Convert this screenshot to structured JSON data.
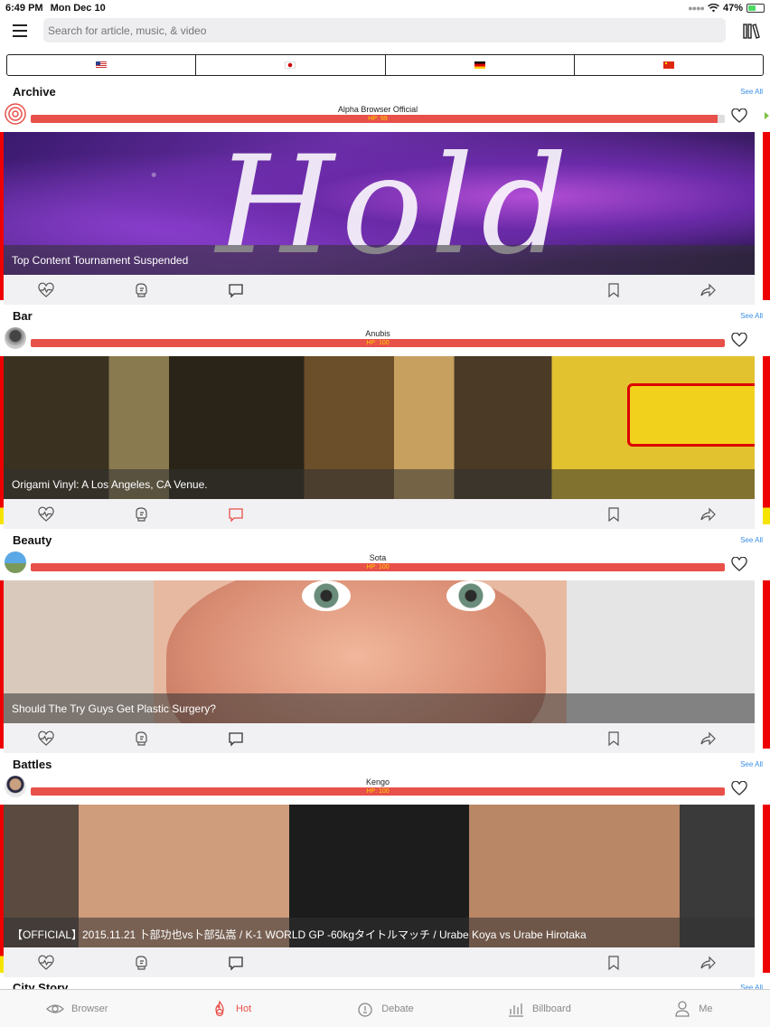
{
  "status_bar": {
    "time": "6:49 PM",
    "date": "Mon Dec 10",
    "battery": "47%",
    "battery_level": 0.47
  },
  "search": {
    "placeholder": "Search for article, music, & video"
  },
  "flag_tabs": [
    {
      "icon": "us-flag-icon"
    },
    {
      "icon": "japan-flag-icon"
    },
    {
      "icon": "germany-flag-icon"
    },
    {
      "icon": "china-flag-icon"
    }
  ],
  "see_all_label": "See All",
  "sections": [
    {
      "title": "Archive",
      "author": "Alpha Browser Official",
      "hp_label": "HP: 99",
      "hp_value": 99,
      "caption": "Top Content Tournament Suspended",
      "comment_active": false,
      "image_text": "Hold"
    },
    {
      "title": "Bar",
      "author": "Anubis",
      "hp_label": "HP: 100",
      "hp_value": 100,
      "caption": "Origami Vinyl: A Los Angeles, CA Venue.",
      "comment_active": true
    },
    {
      "title": "Beauty",
      "author": "Sota",
      "hp_label": "HP: 100",
      "hp_value": 100,
      "caption": "Should The Try Guys Get Plastic Surgery?",
      "comment_active": false
    },
    {
      "title": "Battles",
      "author": "Kengo",
      "hp_label": "HP: 100",
      "hp_value": 100,
      "caption": "【OFFICIAL】2015.11.21 卜部功也vs卜部弘嵩 / K-1 WORLD GP -60kgタイトルマッチ / Urabe Koya vs Urabe Hirotaka",
      "comment_active": false
    }
  ],
  "next_section": {
    "title": "City Story"
  },
  "tabs": [
    {
      "label": "Browser",
      "icon": "eye-icon"
    },
    {
      "label": "Hot",
      "icon": "flame-icon",
      "active": true
    },
    {
      "label": "Debate",
      "icon": "debate-icon"
    },
    {
      "label": "Billboard",
      "icon": "bar-chart-icon"
    },
    {
      "label": "Me",
      "icon": "person-icon"
    }
  ],
  "colors": {
    "accent": "#e8504a",
    "hp_text": "#ffd400",
    "link": "#3a8ee6"
  }
}
